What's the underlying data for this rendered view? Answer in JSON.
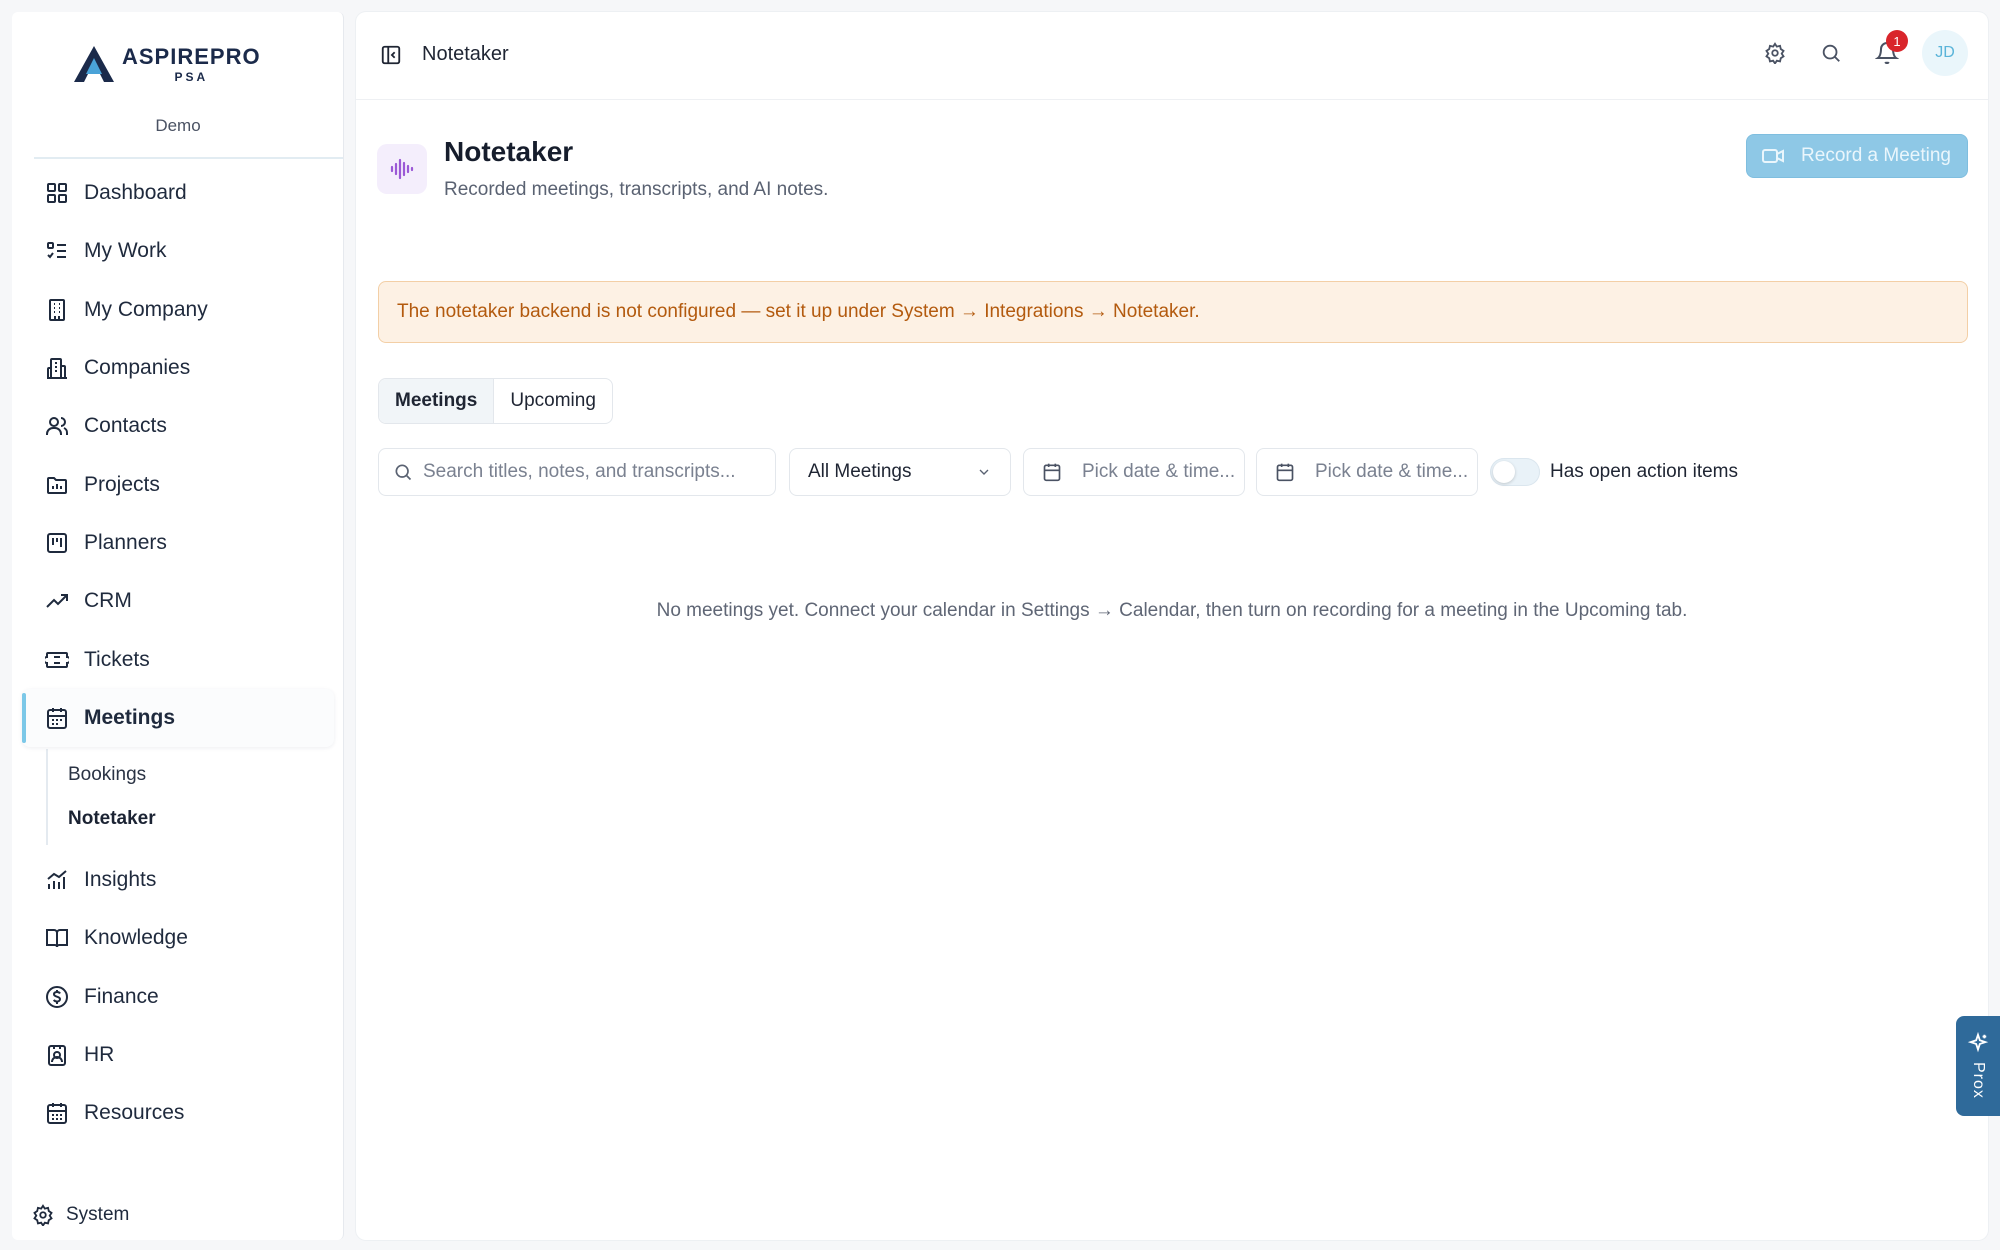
{
  "brand": {
    "name": "ASPIREPRO",
    "sub": "PSA",
    "environment": "Demo"
  },
  "sidebar": {
    "items": [
      {
        "label": "Dashboard",
        "icon": "dashboard-grid-icon"
      },
      {
        "label": "My Work",
        "icon": "checklist-icon"
      },
      {
        "label": "My Company",
        "icon": "building-icon"
      },
      {
        "label": "Companies",
        "icon": "buildings-icon"
      },
      {
        "label": "Contacts",
        "icon": "users-icon"
      },
      {
        "label": "Projects",
        "icon": "folder-chart-icon"
      },
      {
        "label": "Planners",
        "icon": "kanban-icon"
      },
      {
        "label": "CRM",
        "icon": "trending-up-icon"
      },
      {
        "label": "Tickets",
        "icon": "ticket-icon"
      },
      {
        "label": "Meetings",
        "icon": "calendar-icon"
      },
      {
        "label": "Insights",
        "icon": "bar-chart-icon"
      },
      {
        "label": "Knowledge",
        "icon": "book-icon"
      },
      {
        "label": "Finance",
        "icon": "dollar-circle-icon"
      },
      {
        "label": "HR",
        "icon": "id-badge-icon"
      },
      {
        "label": "Resources",
        "icon": "calendar-grid-icon"
      }
    ],
    "meetings_sub": [
      {
        "label": "Bookings"
      },
      {
        "label": "Notetaker"
      }
    ],
    "system_label": "System"
  },
  "topbar": {
    "breadcrumb": "Notetaker",
    "notification_count": "1",
    "avatar_initials": "JD"
  },
  "header": {
    "title": "Notetaker",
    "subtitle": "Recorded meetings, transcripts, and AI notes.",
    "record_button": "Record a Meeting"
  },
  "alert": {
    "text": "The notetaker backend is not configured — set it up under System → Integrations → Notetaker."
  },
  "tabs": [
    {
      "label": "Meetings",
      "active": true
    },
    {
      "label": "Upcoming",
      "active": false
    }
  ],
  "filters": {
    "search_placeholder": "Search titles, notes, and transcripts...",
    "meeting_filter": "All Meetings",
    "date_from_placeholder": "Pick date & time...",
    "date_to_placeholder": "Pick date & time...",
    "toggle_label": "Has open action items",
    "toggle_on": false
  },
  "empty_state": "No meetings yet. Connect your calendar in Settings → Calendar, then turn on recording for a meeting in the Upcoming tab.",
  "assistant": {
    "label": "Prox"
  },
  "colors": {
    "accent": "#8ec8e6",
    "alert_bg": "#fdf1e4",
    "alert_text": "#b35a0e",
    "badge": "#d9252b",
    "brand": "#1b2a4a"
  }
}
